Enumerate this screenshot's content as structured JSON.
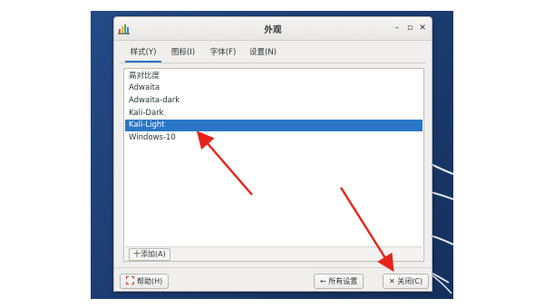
{
  "window": {
    "title": "外观",
    "minimize_glyph": "–",
    "maximize_glyph": "▫",
    "close_glyph": "✕"
  },
  "tabs": [
    {
      "label": "样式(Y)"
    },
    {
      "label": "图标(I)"
    },
    {
      "label": "字体(F)"
    },
    {
      "label": "设置(N)"
    }
  ],
  "theme_list": {
    "items": [
      {
        "label": "高对比度"
      },
      {
        "label": "Adwaita"
      },
      {
        "label": "Adwaita-dark"
      },
      {
        "label": "Kali-Dark"
      },
      {
        "label": "Kali-Light"
      },
      {
        "label": "Windows-10"
      }
    ],
    "selected": "Kali-Light",
    "add_button": "十添加(A)"
  },
  "buttons": {
    "help": "帮助(H)",
    "all_settings": "← 所有设置",
    "close": "✕ 关闭(C)"
  },
  "colors": {
    "selection": "#2a76c6",
    "annotation_arrow": "#e8231b",
    "desktop": "#1c3d74"
  },
  "icons": {
    "app": "appearance-palette-icon",
    "help": "help-icon",
    "arrow_left": "arrow-left-icon",
    "close": "close-icon"
  }
}
